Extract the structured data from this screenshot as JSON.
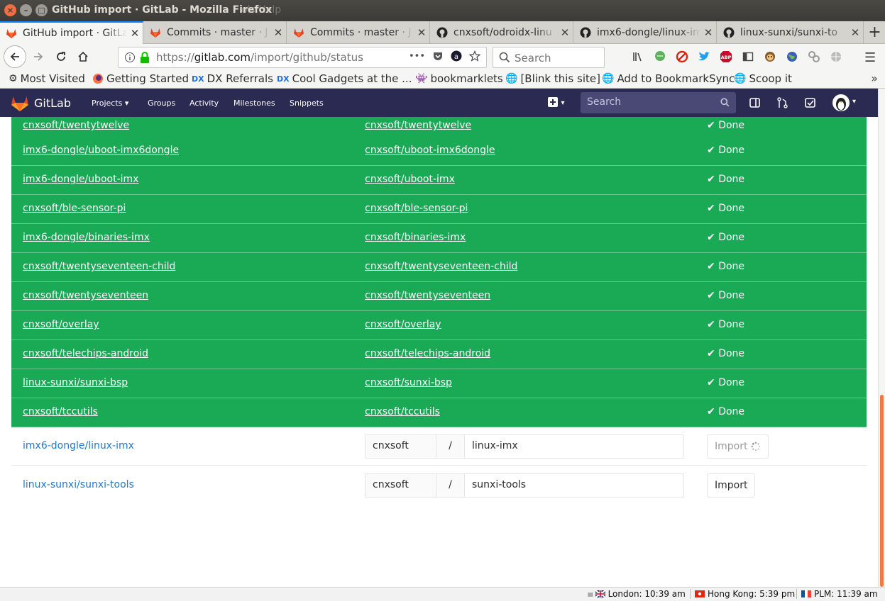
{
  "window": {
    "title": "GitHub import · GitLab - Mozilla Firefox",
    "ghost_menu": "ols  Help"
  },
  "tabs": [
    {
      "label": "GitHub import · GitLab",
      "icon": "gitlab-icon",
      "active": true
    },
    {
      "label": "Commits · master · J",
      "icon": "gitlab-icon",
      "active": false
    },
    {
      "label": "Commits · master · J",
      "icon": "gitlab-icon",
      "active": false
    },
    {
      "label": "cnxsoft/odroidx-linu",
      "icon": "github-icon",
      "active": false
    },
    {
      "label": "imx6-dongle/linux-im",
      "icon": "github-icon",
      "active": false
    },
    {
      "label": "linux-sunxi/sunxi-to",
      "icon": "github-icon",
      "active": false
    }
  ],
  "newtab_label": "+",
  "nav": {
    "url_prefix": "https://",
    "url_host": "gitlab.com",
    "url_path": "/import/github/status",
    "url_more": "•••",
    "search_placeholder": "Search"
  },
  "bookmarks": [
    {
      "label": "Most Visited",
      "icon": "gear-icon"
    },
    {
      "label": "Getting Started",
      "icon": "firefox-icon"
    },
    {
      "label": "DX Referrals",
      "icon": "dx-icon"
    },
    {
      "label": "Cool Gadgets at the ...",
      "icon": "dx-icon"
    },
    {
      "label": "bookmarklets",
      "icon": "reddit-icon"
    },
    {
      "label": "[Blink this site]",
      "icon": "globe-icon"
    },
    {
      "label": "Add to BookmarkSync",
      "icon": "globe-icon"
    },
    {
      "label": "Scoop it",
      "icon": "globe-icon"
    }
  ],
  "gitlab": {
    "name": "GitLab",
    "nav": [
      "Projects",
      "Groups",
      "Activity",
      "Milestones",
      "Snippets"
    ],
    "search_placeholder": "Search",
    "brand_color": "#2b2a53",
    "success_color": "#1aaa55",
    "link_color": "#1f78d1"
  },
  "done_rows": [
    {
      "source": "cnxsoft/twentytwelve",
      "target": "cnxsoft/twentytwelve",
      "status": "Done"
    },
    {
      "source": "imx6-dongle/uboot-imx6dongle",
      "target": "cnxsoft/uboot-imx6dongle",
      "status": "Done"
    },
    {
      "source": "imx6-dongle/uboot-imx",
      "target": "cnxsoft/uboot-imx",
      "status": "Done"
    },
    {
      "source": "cnxsoft/ble-sensor-pi",
      "target": "cnxsoft/ble-sensor-pi",
      "status": "Done"
    },
    {
      "source": "imx6-dongle/binaries-imx",
      "target": "cnxsoft/binaries-imx",
      "status": "Done"
    },
    {
      "source": "cnxsoft/twentyseventeen-child",
      "target": "cnxsoft/twentyseventeen-child",
      "status": "Done"
    },
    {
      "source": "cnxsoft/twentyseventeen",
      "target": "cnxsoft/twentyseventeen",
      "status": "Done"
    },
    {
      "source": "cnxsoft/overlay",
      "target": "cnxsoft/overlay",
      "status": "Done"
    },
    {
      "source": "cnxsoft/telechips-android",
      "target": "cnxsoft/telechips-android",
      "status": "Done"
    },
    {
      "source": "linux-sunxi/sunxi-bsp",
      "target": "cnxsoft/sunxi-bsp",
      "status": "Done"
    },
    {
      "source": "cnxsoft/tccutils",
      "target": "cnxsoft/tccutils",
      "status": "Done"
    }
  ],
  "pending_rows": [
    {
      "source": "imx6-dongle/linux-imx",
      "namespace": "cnxsoft",
      "separator": "/",
      "name": "linux-imx",
      "button": "Import",
      "importing": true
    },
    {
      "source": "linux-sunxi/sunxi-tools",
      "namespace": "cnxsoft",
      "separator": "/",
      "name": "sunxi-tools",
      "button": "Import",
      "importing": false
    }
  ],
  "status_bar": [
    {
      "label": "London: 10:39 am",
      "flag": "uk"
    },
    {
      "label": "Hong Kong: 5:39 pm",
      "flag": "hk"
    },
    {
      "label": "PLM: 11:39 am",
      "flag": "fr"
    }
  ]
}
